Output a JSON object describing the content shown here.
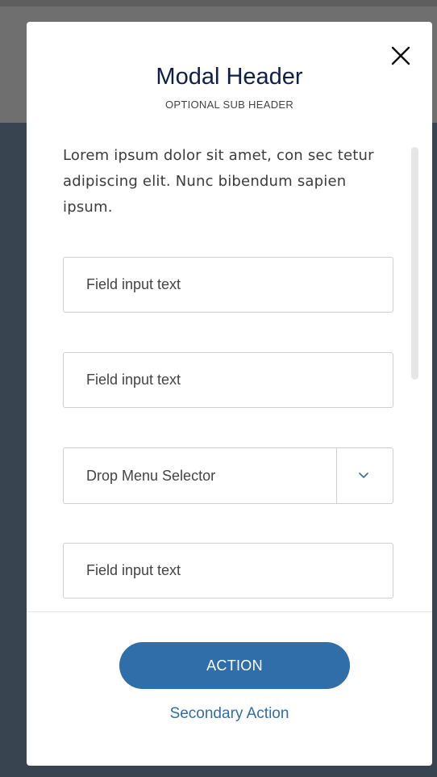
{
  "modal": {
    "title": "Modal Header",
    "subtitle": "OPTIONAL SUB HEADER",
    "body_text": "Lorem ipsum dolor sit amet, con sec tetur adipiscing elit. Nunc bibendum sapien ipsum.",
    "close_icon": "close-icon"
  },
  "form": {
    "field_1": {
      "placeholder": "Field input text"
    },
    "field_2": {
      "placeholder": "Field input text"
    },
    "dropdown": {
      "value": "Drop Menu Selector",
      "icon": "chevron-down-icon"
    },
    "field_3": {
      "placeholder": "Field input text"
    }
  },
  "actions": {
    "primary_label": "ACTION",
    "secondary_label": "Secondary Action"
  },
  "colors": {
    "primary": "#2f6ea8",
    "title": "#0f1f4a",
    "backdrop": "#384550"
  }
}
